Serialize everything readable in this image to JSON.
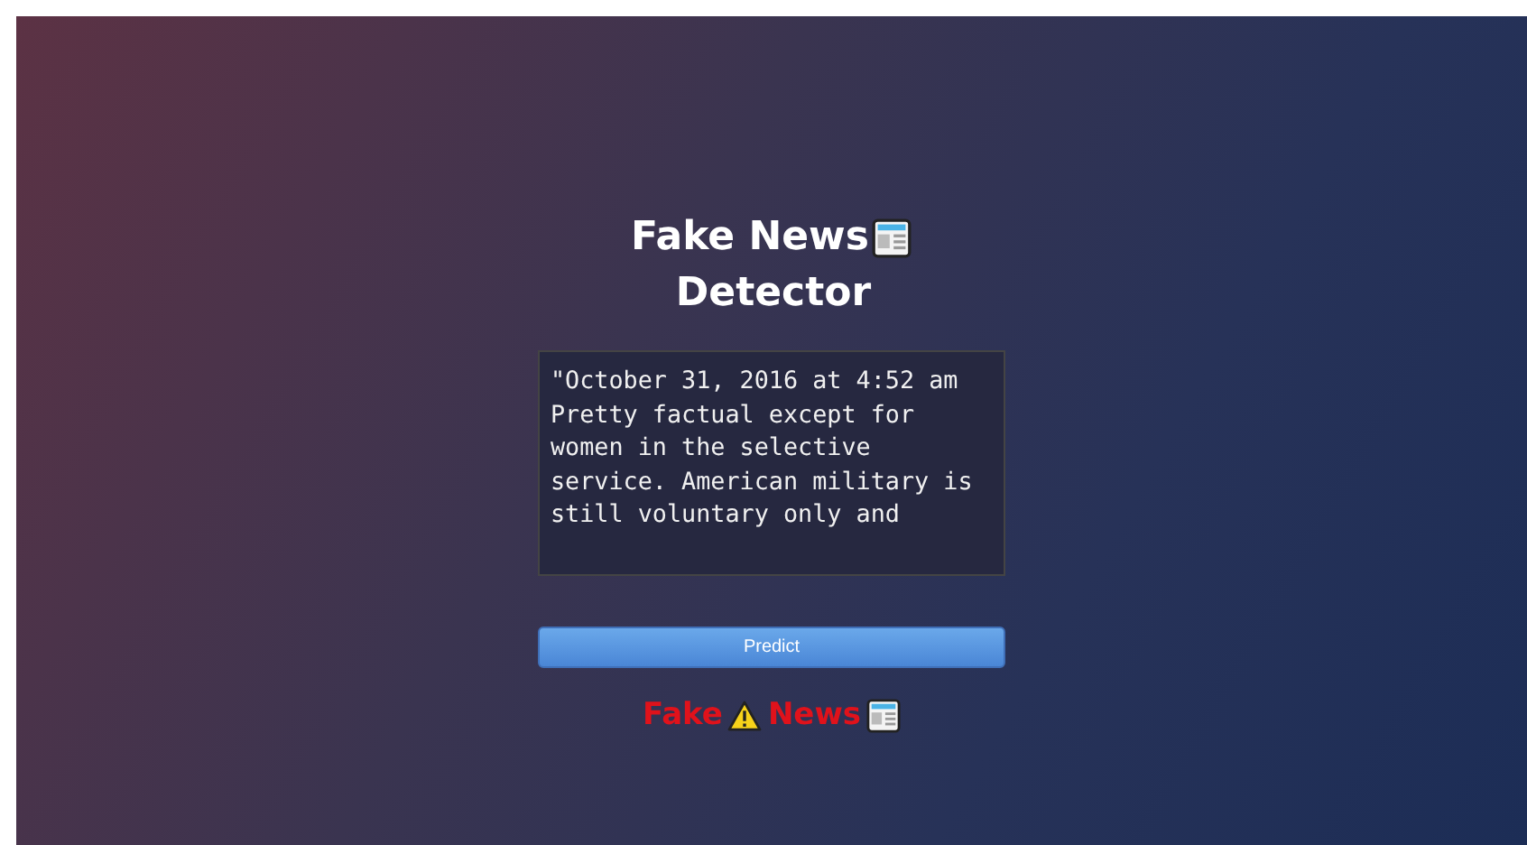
{
  "title": {
    "line_1": "Fake News",
    "line_2": "Detector"
  },
  "article_field": {
    "value": "\"October 31, 2016 at 4:52 am\nPretty factual except for women in the selective service. American military is still voluntary only and"
  },
  "predict_button": {
    "label": "Predict"
  },
  "result": {
    "kind": "fake",
    "first_word": "Fake",
    "second_word": "News"
  }
}
